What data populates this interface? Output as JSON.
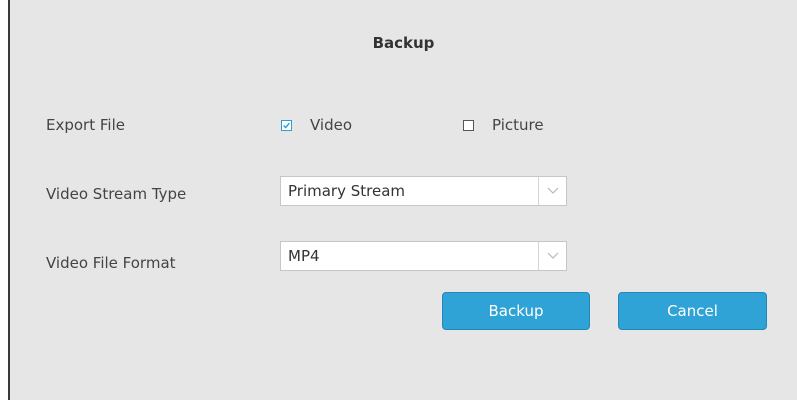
{
  "dialog": {
    "title": "Backup"
  },
  "export_file": {
    "label": "Export File",
    "options": [
      {
        "label": "Video",
        "checked": true
      },
      {
        "label": "Picture",
        "checked": false
      }
    ]
  },
  "stream_type": {
    "label": "Video Stream Type",
    "value": "Primary Stream"
  },
  "file_format": {
    "label": "Video File Format",
    "value": "MP4"
  },
  "buttons": {
    "backup": "Backup",
    "cancel": "Cancel"
  },
  "colors": {
    "accent": "#2fa2d6",
    "background": "#e6e6e6"
  }
}
